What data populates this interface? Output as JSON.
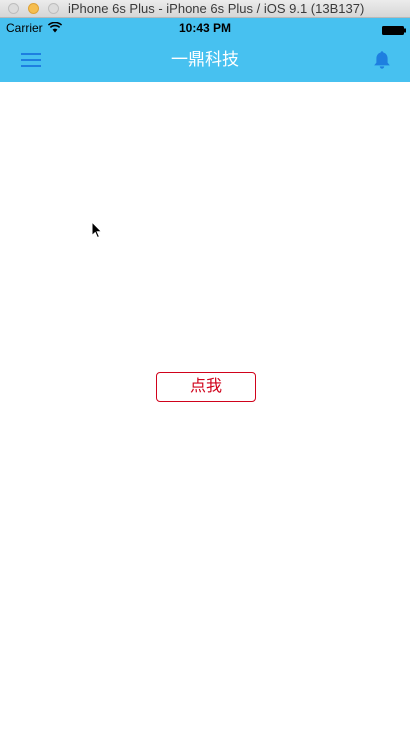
{
  "window": {
    "title": "iPhone 6s Plus - iPhone 6s Plus / iOS 9.1 (13B137)"
  },
  "status_bar": {
    "carrier": "Carrier",
    "time": "10:43 PM",
    "wifi_icon": "wifi-icon",
    "battery_icon": "battery-icon"
  },
  "nav_bar": {
    "title": "一鼎科技",
    "menu_icon": "hamburger-menu-icon",
    "bell_icon": "bell-icon",
    "background_color": "#47c1f0",
    "icon_color": "#1e7fe0"
  },
  "main": {
    "button_label": "点我",
    "button_color": "#d0021b"
  }
}
